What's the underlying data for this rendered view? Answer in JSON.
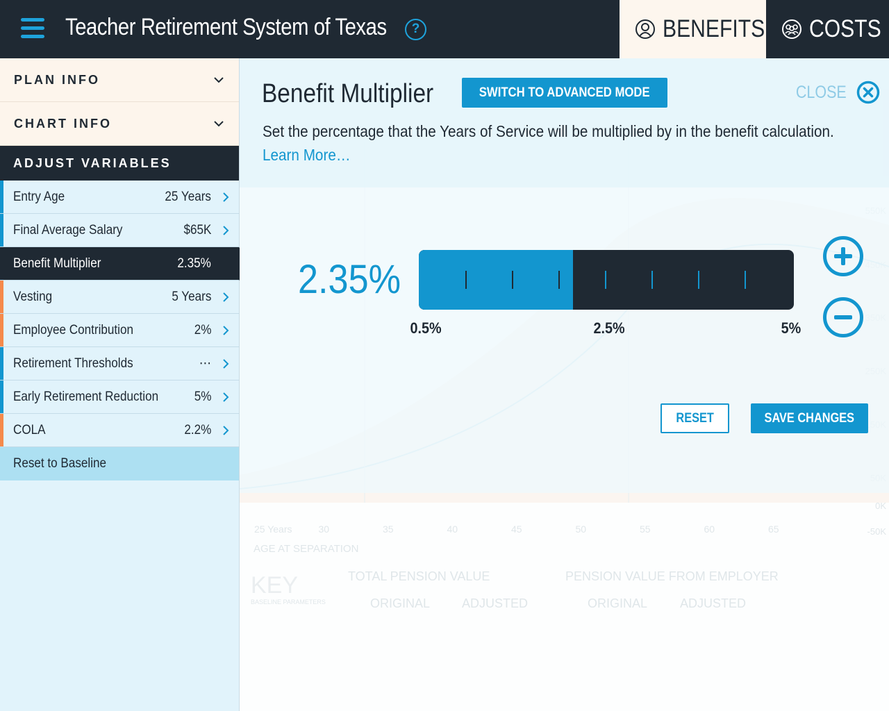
{
  "header": {
    "app_title": "Teacher Retirement System of Texas",
    "help_icon": "?",
    "tabs": [
      {
        "label": "BENEFITS",
        "icon": "person-icon",
        "active": true
      },
      {
        "label": "COSTS",
        "icon": "group-icon",
        "active": false
      }
    ]
  },
  "sidebar": {
    "accordions": [
      {
        "label": "PLAN INFO"
      },
      {
        "label": "CHART INFO"
      }
    ],
    "adjust_heading": "ADJUST VARIABLES",
    "variables": [
      {
        "name": "Entry Age",
        "value": "25 Years",
        "color": "#1396cf"
      },
      {
        "name": "Final Average Salary",
        "value": "$65K",
        "color": "#1396cf"
      },
      {
        "name": "Benefit Multiplier",
        "value": "2.35%",
        "color": "#1396cf",
        "active": true
      },
      {
        "name": "Vesting",
        "value": "5 Years",
        "color": "#f58a4b"
      },
      {
        "name": "Employee Contribution",
        "value": "2%",
        "color": "#f58a4b"
      },
      {
        "name": "Retirement Thresholds",
        "value": "⋯",
        "color": "#1396cf"
      },
      {
        "name": "Early Retirement Reduction",
        "value": "5%",
        "color": "#1396cf"
      },
      {
        "name": "COLA",
        "value": "2.2%",
        "color": "#f58a4b"
      }
    ],
    "reset_label": "Reset to Baseline"
  },
  "panel": {
    "title": "Benefit Multiplier",
    "advanced_button": "SWITCH TO ADVANCED MODE",
    "close_label": "CLOSE",
    "description": "Set the percentage that the Years of Service will be multiplied by in the benefit calculation.",
    "learn_more": "Learn More…",
    "current_value": "2.35%",
    "slider": {
      "min": 0.5,
      "max": 5,
      "value": 2.35,
      "labels": [
        "0.5%",
        "2.5%",
        "5%"
      ]
    },
    "reset_button": "RESET",
    "save_button": "SAVE CHANGES"
  },
  "background_chart": {
    "y_ticks": [
      "550K",
      "450K",
      "350K",
      "250K",
      "150K",
      "50K",
      "0K",
      "-50K"
    ],
    "x_ticks": [
      "25 Years",
      "30",
      "35",
      "40",
      "45",
      "50",
      "55",
      "60",
      "65"
    ],
    "x_axis_label": "AGE AT SEPARATION",
    "key_title": "KEY",
    "key_subtitle": "BASELINE PARAMETERS",
    "legend_groups": [
      {
        "title": "TOTAL PENSION VALUE",
        "items": [
          "ORIGINAL",
          "ADJUSTED"
        ]
      },
      {
        "title": "PENSION VALUE FROM EMPLOYER",
        "items": [
          "ORIGINAL",
          "ADJUSTED"
        ]
      }
    ]
  }
}
